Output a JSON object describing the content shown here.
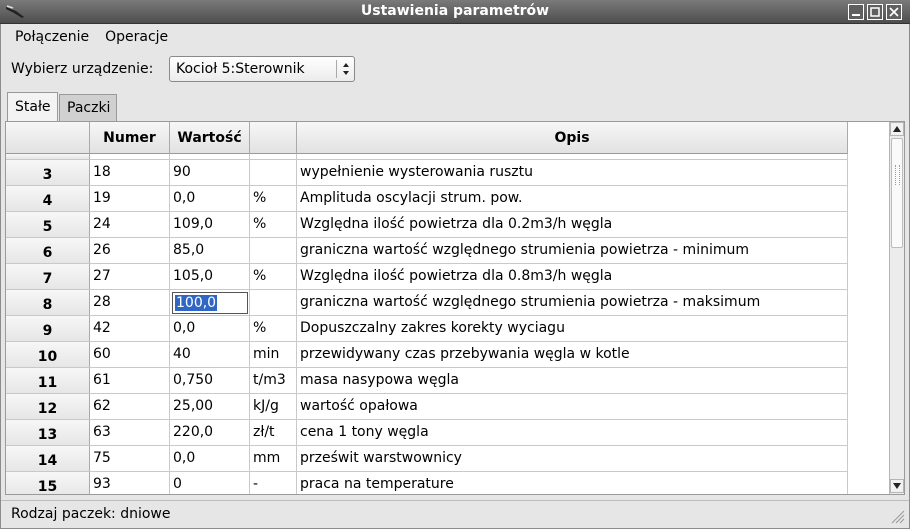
{
  "window": {
    "title": "Ustawienia parametrów"
  },
  "menu": {
    "items": [
      "Połączenie",
      "Operacje"
    ]
  },
  "device": {
    "label": "Wybierz urządzenie:",
    "selected": "Kocioł 5:Sterownik"
  },
  "tabs": [
    {
      "label": "Stałe",
      "active": true
    },
    {
      "label": "Paczki",
      "active": false
    }
  ],
  "table": {
    "headers": {
      "rownum": "",
      "numer": "Numer",
      "wartosc": "Wartość",
      "jednostka": "",
      "opis": "Opis"
    },
    "rows": [
      {
        "n": "3",
        "numer": "18",
        "wartosc": "90",
        "jednostka": "",
        "opis": "wypełnienie wysterowania rusztu"
      },
      {
        "n": "4",
        "numer": "19",
        "wartosc": "0,0",
        "jednostka": "%",
        "opis": "Amplituda oscylacji strum. pow."
      },
      {
        "n": "5",
        "numer": "24",
        "wartosc": "109,0",
        "jednostka": "%",
        "opis": "Względna ilość powietrza dla 0.2m3/h węgla"
      },
      {
        "n": "6",
        "numer": "26",
        "wartosc": "85,0",
        "jednostka": "",
        "opis": "graniczna wartość względnego strumienia powietrza - minimum"
      },
      {
        "n": "7",
        "numer": "27",
        "wartosc": "105,0",
        "jednostka": "%",
        "opis": "Względna ilość powietrza dla 0.8m3/h węgla"
      },
      {
        "n": "8",
        "numer": "28",
        "wartosc": "100,0",
        "jednostka": "",
        "opis": "graniczna wartość względnego strumienia powietrza - maksimum",
        "editing": true
      },
      {
        "n": "9",
        "numer": "42",
        "wartosc": "0,0",
        "jednostka": "%",
        "opis": "Dopuszczalny zakres korekty wyciagu"
      },
      {
        "n": "10",
        "numer": "60",
        "wartosc": "40",
        "jednostka": "min",
        "opis": "przewidywany czas przebywania węgla w kotle"
      },
      {
        "n": "11",
        "numer": "61",
        "wartosc": "0,750",
        "jednostka": "t/m3",
        "opis": "masa nasypowa węgla"
      },
      {
        "n": "12",
        "numer": "62",
        "wartosc": "25,00",
        "jednostka": "kJ/g",
        "opis": "wartość opałowa"
      },
      {
        "n": "13",
        "numer": "63",
        "wartosc": "220,0",
        "jednostka": "zł/t",
        "opis": "cena 1 tony węgla"
      },
      {
        "n": "14",
        "numer": "75",
        "wartosc": "0,0",
        "jednostka": "mm",
        "opis": "prześwit warstwownicy"
      },
      {
        "n": "15",
        "numer": "93",
        "wartosc": "0",
        "jednostka": "-",
        "opis": "praca na temperature"
      }
    ]
  },
  "status": {
    "text": "Rodzaj paczek: dniowe"
  }
}
